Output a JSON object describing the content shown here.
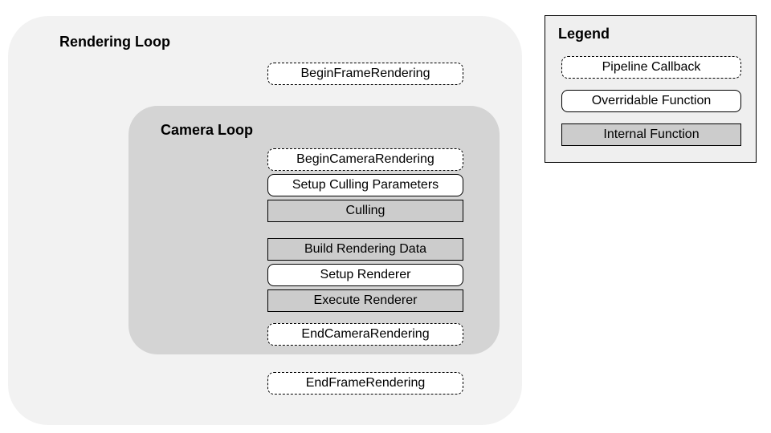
{
  "rendering_loop": {
    "title": "Rendering Loop",
    "begin": "BeginFrameRendering",
    "end": "EndFrameRendering"
  },
  "camera_loop": {
    "title": "Camera Loop",
    "steps": {
      "begin": "BeginCameraRendering",
      "setup_culling": "Setup Culling Parameters",
      "culling": "Culling",
      "build_data": "Build Rendering Data",
      "setup_renderer": "Setup Renderer",
      "execute_renderer": "Execute Renderer",
      "end": "EndCameraRendering"
    }
  },
  "legend": {
    "title": "Legend",
    "callback": "Pipeline Callback",
    "overridable": "Overridable Function",
    "internal": "Internal Function"
  }
}
